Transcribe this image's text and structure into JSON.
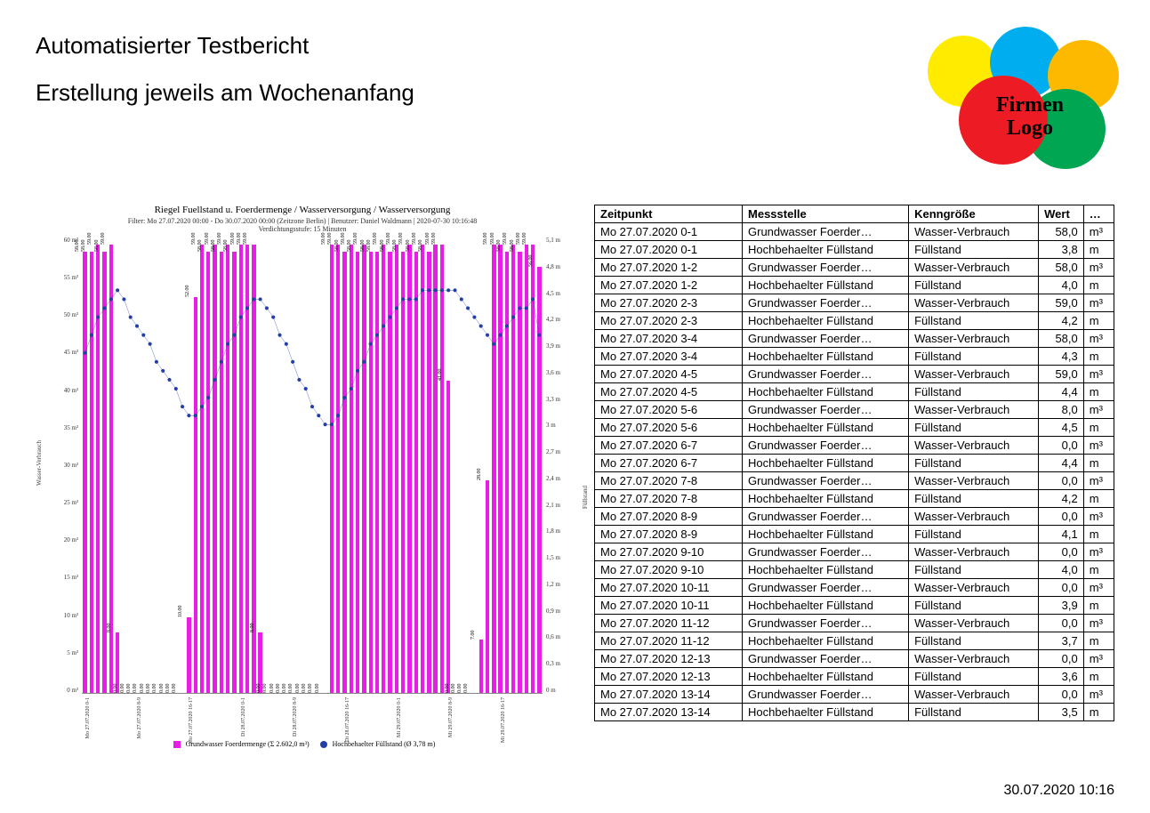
{
  "titles": {
    "main": "Automatisierter Testbericht",
    "sub": "Erstellung jeweils am Wochenanfang"
  },
  "logo": {
    "line1": "Firmen",
    "line2": "Logo"
  },
  "footer_timestamp": "30.07.2020 10:16",
  "table": {
    "headers": [
      "Zeitpunkt",
      "Messstelle",
      "Kenngröße",
      "Wert",
      "…"
    ],
    "rows": [
      [
        "Mo 27.07.2020 0-1",
        "Grundwasser Foerder…",
        "Wasser-Verbrauch",
        "58,0",
        "m³"
      ],
      [
        "Mo 27.07.2020 0-1",
        "Hochbehaelter Füllstand",
        "Füllstand",
        "3,8",
        "m"
      ],
      [
        "Mo 27.07.2020 1-2",
        "Grundwasser Foerder…",
        "Wasser-Verbrauch",
        "58,0",
        "m³"
      ],
      [
        "Mo 27.07.2020 1-2",
        "Hochbehaelter Füllstand",
        "Füllstand",
        "4,0",
        "m"
      ],
      [
        "Mo 27.07.2020 2-3",
        "Grundwasser Foerder…",
        "Wasser-Verbrauch",
        "59,0",
        "m³"
      ],
      [
        "Mo 27.07.2020 2-3",
        "Hochbehaelter Füllstand",
        "Füllstand",
        "4,2",
        "m"
      ],
      [
        "Mo 27.07.2020 3-4",
        "Grundwasser Foerder…",
        "Wasser-Verbrauch",
        "58,0",
        "m³"
      ],
      [
        "Mo 27.07.2020 3-4",
        "Hochbehaelter Füllstand",
        "Füllstand",
        "4,3",
        "m"
      ],
      [
        "Mo 27.07.2020 4-5",
        "Grundwasser Foerder…",
        "Wasser-Verbrauch",
        "59,0",
        "m³"
      ],
      [
        "Mo 27.07.2020 4-5",
        "Hochbehaelter Füllstand",
        "Füllstand",
        "4,4",
        "m"
      ],
      [
        "Mo 27.07.2020 5-6",
        "Grundwasser Foerder…",
        "Wasser-Verbrauch",
        "8,0",
        "m³"
      ],
      [
        "Mo 27.07.2020 5-6",
        "Hochbehaelter Füllstand",
        "Füllstand",
        "4,5",
        "m"
      ],
      [
        "Mo 27.07.2020 6-7",
        "Grundwasser Foerder…",
        "Wasser-Verbrauch",
        "0,0",
        "m³"
      ],
      [
        "Mo 27.07.2020 6-7",
        "Hochbehaelter Füllstand",
        "Füllstand",
        "4,4",
        "m"
      ],
      [
        "Mo 27.07.2020 7-8",
        "Grundwasser Foerder…",
        "Wasser-Verbrauch",
        "0,0",
        "m³"
      ],
      [
        "Mo 27.07.2020 7-8",
        "Hochbehaelter Füllstand",
        "Füllstand",
        "4,2",
        "m"
      ],
      [
        "Mo 27.07.2020 8-9",
        "Grundwasser Foerder…",
        "Wasser-Verbrauch",
        "0,0",
        "m³"
      ],
      [
        "Mo 27.07.2020 8-9",
        "Hochbehaelter Füllstand",
        "Füllstand",
        "4,1",
        "m"
      ],
      [
        "Mo 27.07.2020 9-10",
        "Grundwasser Foerder…",
        "Wasser-Verbrauch",
        "0,0",
        "m³"
      ],
      [
        "Mo 27.07.2020 9-10",
        "Hochbehaelter Füllstand",
        "Füllstand",
        "4,0",
        "m"
      ],
      [
        "Mo 27.07.2020 10-11",
        "Grundwasser Foerder…",
        "Wasser-Verbrauch",
        "0,0",
        "m³"
      ],
      [
        "Mo 27.07.2020 10-11",
        "Hochbehaelter Füllstand",
        "Füllstand",
        "3,9",
        "m"
      ],
      [
        "Mo 27.07.2020 11-12",
        "Grundwasser Foerder…",
        "Wasser-Verbrauch",
        "0,0",
        "m³"
      ],
      [
        "Mo 27.07.2020 11-12",
        "Hochbehaelter Füllstand",
        "Füllstand",
        "3,7",
        "m"
      ],
      [
        "Mo 27.07.2020 12-13",
        "Grundwasser Foerder…",
        "Wasser-Verbrauch",
        "0,0",
        "m³"
      ],
      [
        "Mo 27.07.2020 12-13",
        "Hochbehaelter Füllstand",
        "Füllstand",
        "3,6",
        "m"
      ],
      [
        "Mo 27.07.2020 13-14",
        "Grundwasser Foerder…",
        "Wasser-Verbrauch",
        "0,0",
        "m³"
      ],
      [
        "Mo 27.07.2020 13-14",
        "Hochbehaelter Füllstand",
        "Füllstand",
        "3,5",
        "m"
      ]
    ]
  },
  "chart": {
    "title": "Riegel Fuellstand u. Foerdermenge / Wasserversorgung / Wasserversorgung",
    "subtitle1": "Filter: Mo 27.07.2020 00:00 - Do 30.07.2020 00:00 (Zeitzone Berlin) | Benutzer: Daniel Waldmann | 2020-07-30 10:16:48",
    "subtitle2": "Verdichtungsstufe: 15 Minuten",
    "legend_bar": "Grundwasser Foerdermenge (Σ 2.602,0 m³)",
    "legend_line": "Hochbehaelter Füllstand (Ø 3,78 m)",
    "ylabel_left": "Wasser-Verbrauch",
    "ylabel_right": "Füllstand",
    "y_left_ticks": [
      "60 m³",
      "55 m³",
      "50 m³",
      "45 m³",
      "40 m³",
      "35 m³",
      "30 m³",
      "25 m³",
      "20 m³",
      "15 m³",
      "10 m³",
      "5 m³",
      "0 m³"
    ],
    "y_right_ticks": [
      "5,1 m",
      "4,8 m",
      "4,5 m",
      "4,2 m",
      "3,9 m",
      "3,6 m",
      "3,3 m",
      "3 m",
      "2,7 m",
      "2,4 m",
      "2,1 m",
      "1,8 m",
      "1,5 m",
      "1,2 m",
      "0,9 m",
      "0,6 m",
      "0,3 m",
      "0 m"
    ]
  },
  "chart_data": {
    "type": "bar",
    "y_left_range": [
      0,
      60
    ],
    "y_right_range": [
      0,
      5.1
    ],
    "series": [
      {
        "name": "Grundwasser Foerdermenge",
        "axis": "left",
        "unit": "m³",
        "values": [
          58,
          58,
          59,
          58,
          59,
          8,
          0,
          0,
          0,
          0,
          0,
          0,
          0,
          0,
          0,
          0,
          10,
          52,
          59,
          58,
          59,
          58,
          59,
          58,
          59,
          59,
          59,
          8,
          0,
          0,
          0,
          0,
          0,
          0,
          0,
          0,
          0,
          0,
          59,
          59,
          58,
          59,
          58,
          59,
          58,
          58,
          59,
          58,
          59,
          58,
          59,
          58,
          59,
          58,
          59,
          59,
          41,
          0,
          0,
          0,
          0,
          7,
          28,
          59,
          59,
          58,
          59,
          58,
          59,
          59,
          56
        ]
      },
      {
        "name": "Hochbehaelter Füllstand",
        "axis": "right",
        "unit": "m",
        "values": [
          3.8,
          4.0,
          4.2,
          4.3,
          4.4,
          4.5,
          4.4,
          4.2,
          4.1,
          4.0,
          3.9,
          3.7,
          3.6,
          3.5,
          3.4,
          3.2,
          3.1,
          3.1,
          3.2,
          3.3,
          3.5,
          3.7,
          3.9,
          4.0,
          4.2,
          4.3,
          4.4,
          4.4,
          4.3,
          4.2,
          4.0,
          3.9,
          3.7,
          3.5,
          3.4,
          3.2,
          3.1,
          3.0,
          3.0,
          3.1,
          3.3,
          3.4,
          3.6,
          3.7,
          3.9,
          4.0,
          4.1,
          4.2,
          4.3,
          4.4,
          4.4,
          4.4,
          4.5,
          4.5,
          4.5,
          4.5,
          4.5,
          4.5,
          4.4,
          4.3,
          4.2,
          4.1,
          4.0,
          3.9,
          4.0,
          4.1,
          4.2,
          4.3,
          4.3,
          4.4,
          4.0
        ]
      }
    ],
    "categories": [
      "Mo 27.07.2020 0-1",
      "",
      "",
      "",
      "",
      "",
      "",
      "",
      "Mo 27.07.2020 8-9",
      "",
      "",
      "",
      "",
      "",
      "",
      "",
      "Mo 27.07.2020 16-17",
      "",
      "",
      "",
      "",
      "",
      "",
      "",
      "Di 28.07.2020 0-1",
      "",
      "",
      "",
      "",
      "",
      "",
      "",
      "Di 28.07.2020 8-9",
      "",
      "",
      "",
      "",
      "",
      "",
      "",
      "Di 28.07.2020 16-17",
      "",
      "",
      "",
      "",
      "",
      "",
      "",
      "Mi 29.07.2020 0-1",
      "",
      "",
      "",
      "",
      "",
      "",
      "",
      "Mi 29.07.2020 8-9",
      "",
      "",
      "",
      "",
      "",
      "",
      "",
      "Mi 29.07.2020 16-17",
      "",
      "",
      "",
      "",
      "",
      ""
    ],
    "bar_labels": [
      "58.00",
      "58.00",
      "59.00",
      "58.00",
      "59.00",
      "8.00",
      "0.00",
      "0.00",
      "0.00",
      "0.00",
      "0.00",
      "0.00",
      "0.00",
      "0.00",
      "0.00",
      "0.00",
      "10.00",
      "52.00",
      "59.00",
      "58.00",
      "59.00",
      "58.00",
      "59.00",
      "58.00",
      "59.00",
      "59.00",
      "59.00",
      "8.00",
      "0.00",
      "0.00",
      "0.00",
      "0.00",
      "0.00",
      "0.00",
      "0.00",
      "0.00",
      "0.00",
      "0.00",
      "59.00",
      "59.00",
      "58.00",
      "59.00",
      "58.00",
      "59.00",
      "58.00",
      "58.00",
      "59.00",
      "58.00",
      "59.00",
      "58.00",
      "59.00",
      "58.00",
      "59.00",
      "58.00",
      "59.00",
      "59.00",
      "41.00",
      "0.00",
      "0.00",
      "0.00",
      "0.00",
      "7.00",
      "28.00",
      "59.00",
      "59.00",
      "58.00",
      "59.00",
      "58.00",
      "59.00",
      "59.00",
      "56.00"
    ]
  }
}
